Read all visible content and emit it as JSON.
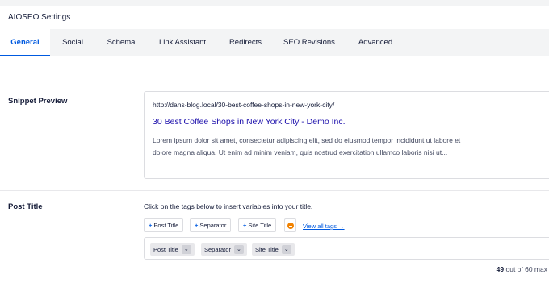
{
  "panel": {
    "title": "AIOSEO Settings"
  },
  "tabs": [
    {
      "label": "General"
    },
    {
      "label": "Social"
    },
    {
      "label": "Schema"
    },
    {
      "label": "Link Assistant"
    },
    {
      "label": "Redirects"
    },
    {
      "label": "SEO Revisions"
    },
    {
      "label": "Advanced"
    }
  ],
  "active_tab": "General",
  "snippet": {
    "label": "Snippet Preview",
    "url": "http://dans-blog.local/30-best-coffee-shops-in-new-york-city/",
    "title": "30 Best Coffee Shops in New York City - Demo Inc.",
    "description": "Lorem ipsum dolor sit amet, consectetur adipiscing elit, sed do eiusmod tempor incididunt ut labore et dolore magna aliqua. Ut enim ad minim veniam, quis nostrud exercitation ullamco laboris nisi ut..."
  },
  "post_title": {
    "label": "Post Title",
    "helper": "Click on the tags below to insert variables into your title.",
    "tag_buttons": [
      {
        "plus": "+",
        "label": "Post Title"
      },
      {
        "plus": "+",
        "label": "Separator"
      },
      {
        "plus": "+",
        "label": "Site Title"
      }
    ],
    "emoji_icon": "emoji-face-icon",
    "view_all": "View all tags →",
    "pills": [
      {
        "label": "Post Title",
        "chevron": "⌄"
      },
      {
        "label": "Separator",
        "chevron": "⌄"
      },
      {
        "label": "Site Title",
        "chevron": "⌄"
      }
    ],
    "count": "49",
    "count_suffix": " out of 60 max"
  },
  "colors": {
    "accent": "#005ae0",
    "snippet_title": "#1a0dab",
    "emoji": "#f18200"
  }
}
